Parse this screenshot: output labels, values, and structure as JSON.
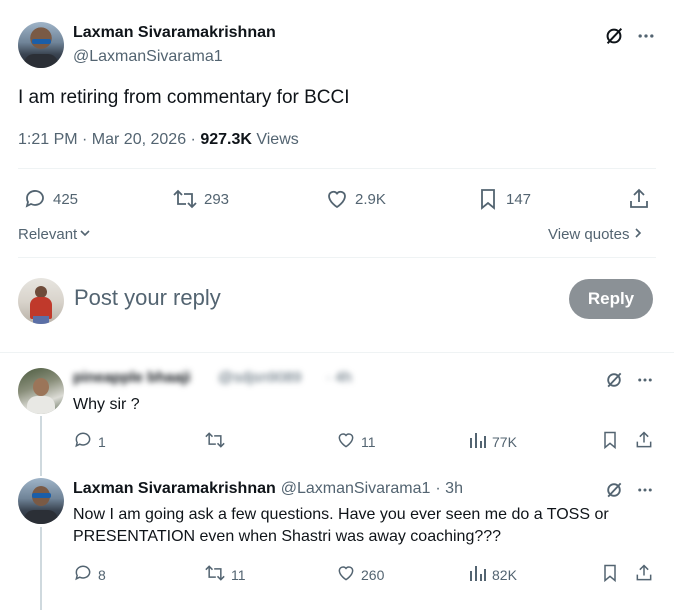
{
  "tweet": {
    "author_name": "Laxman Sivaramakrishnan",
    "author_handle": "@LaxmanSivarama1",
    "text": "I am retiring from commentary for BCCI",
    "time": "1:21 PM · Mar 20, 2026 · ",
    "views_count": "927.3K",
    "views_label": " Views",
    "stats": {
      "replies": "425",
      "reposts": "293",
      "likes": "2.9K",
      "bookmarks": "147"
    },
    "icons": [
      "grok-icon",
      "more-icon",
      "reply-icon",
      "repost-icon",
      "like-icon",
      "bookmark-icon",
      "share-icon"
    ]
  },
  "filters": {
    "sort_label": "Relevant",
    "view_quotes_label": "View quotes"
  },
  "composer": {
    "placeholder": "Post your reply",
    "button_label": "Reply"
  },
  "replies": [
    {
      "author_name": "pineapple bhaaji",
      "author_handle": "@sdjsn9089",
      "time": "· 4h",
      "text": "Why sir ?",
      "stats": {
        "replies": "1",
        "reposts": "",
        "likes": "11",
        "views": "77K"
      }
    },
    {
      "author_name": "Laxman Sivaramakrishnan",
      "author_handle": "@LaxmanSivarama1",
      "time": "· 3h",
      "text_line1": "Now I am going ask a few questions. Have you ever seen me do a TOSS or",
      "text_line2": "PRESENTATION even when Shastri was away coaching???",
      "stats": {
        "replies": "8",
        "reposts": "11",
        "likes": "260",
        "views": "82K"
      }
    }
  ],
  "colors": {
    "text_primary": "#0f1419",
    "text_secondary": "#536471",
    "divider": "#eff3f4",
    "reply_button_disabled": "#8b9196"
  }
}
